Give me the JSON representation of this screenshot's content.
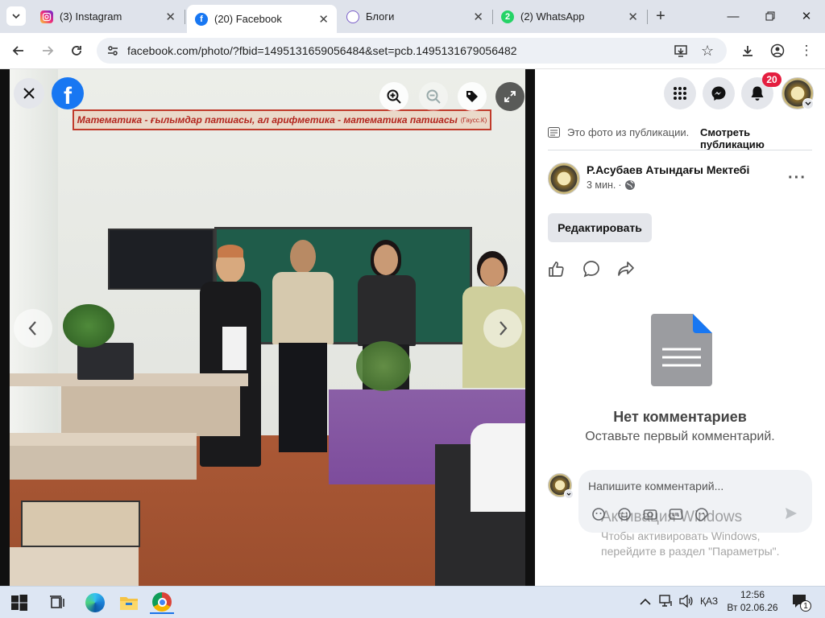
{
  "browser": {
    "tabs": [
      {
        "title": "(3) Instagram",
        "icon": "instagram-icon",
        "color": "#d6249f"
      },
      {
        "title": "(20) Facebook",
        "icon": "facebook-icon",
        "color": "#1877f2",
        "active": true
      },
      {
        "title": "Блоги",
        "icon": "blog-icon",
        "color": "#6a5acd"
      },
      {
        "title": "(2) WhatsApp",
        "icon": "whatsapp-icon",
        "color": "#25d366",
        "badge": "2"
      }
    ],
    "new_tab": "+",
    "url": "facebook.com/photo/?fbid=1495131659056484&set=pcb.1495131679056482"
  },
  "photo": {
    "banner_text": "Математика - ғылымдар патшасы, ал арифметика - математика патшасы",
    "banner_author": "(Гаусс.К)"
  },
  "header": {
    "notifications_count": "20"
  },
  "post": {
    "from_publication": "Это фото из публикации.",
    "view_publication": "Смотреть публикацию",
    "author": "Р.Асубаев Атындағы Мектебі",
    "time": "3 мин.",
    "dot": "·",
    "edit_label": "Редактировать",
    "no_comments_title": "Нет комментариев",
    "no_comments_sub": "Оставьте первый комментарий.",
    "comment_placeholder": "Напишите комментарий..."
  },
  "watermark": {
    "line1": "Активация Windows",
    "line2": "Чтобы активировать Windows,",
    "line3": "перейдите в раздел \"Параметры\"."
  },
  "taskbar": {
    "language": "ҚАЗ",
    "time": "12:56",
    "date": "Вт 02.06.26",
    "notif_count": "1"
  },
  "colors": {
    "facebook_blue": "#1877f2",
    "badge_red": "#e41e3f",
    "panel_gray": "#e4e6eb"
  }
}
